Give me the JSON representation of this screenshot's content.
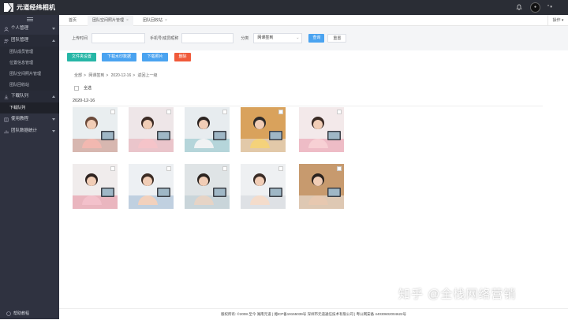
{
  "app": {
    "title": "元道经纬相机",
    "user": "*"
  },
  "sidebar": {
    "groups": [
      {
        "label": "个人管理",
        "items": []
      },
      {
        "label": "团队管理",
        "items": [
          "团队成员管理",
          "位置信息管理",
          "团队空间照片管理",
          "团队回收站"
        ]
      },
      {
        "label": "下载队列",
        "items": [
          "下载队列"
        ]
      },
      {
        "label": "使用教程",
        "items": []
      },
      {
        "label": "团队数据统计",
        "items": []
      }
    ],
    "bottom_link": "帮助教程"
  },
  "tabs": [
    "首页",
    "团队空间照片管理",
    "团队回收站"
  ],
  "ops_label": "操作",
  "search": {
    "time_label": "上传时间",
    "member_label": "手机号/成员昵称",
    "category_label": "分类",
    "category_value": "网课签到",
    "query_button": "查询",
    "reset_button": "重置"
  },
  "actions": {
    "settings": "文件夹设置",
    "download_original": "下载水印数据",
    "download_photo": "下载照片",
    "delete": "删除"
  },
  "breadcrumb": [
    "全部",
    "网课签到",
    "2020-12-16",
    "返回上一级"
  ],
  "select_all": "全选",
  "date_group": "2020-12-16",
  "photo_count": 10,
  "footer": "版权所有: ©2008-至今 湖南元道 | 湘ICP备19155039号 深圳市元道通信技术有限公司 | 粤公网安备 44030602004622号",
  "watermark": "知乎 @全栈网络营销"
}
